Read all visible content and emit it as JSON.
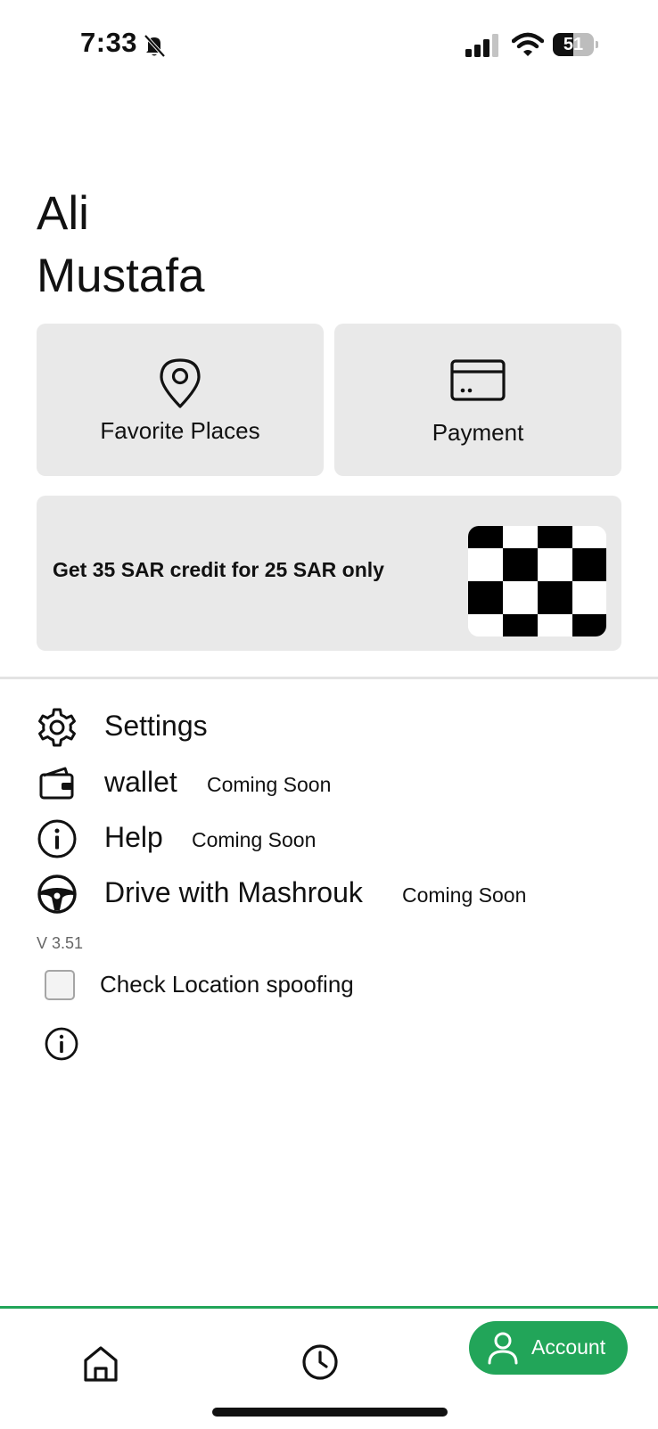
{
  "status_bar": {
    "time": "7:33",
    "battery_percent": 51,
    "battery_label": "51",
    "icons": [
      "bell-slash-icon",
      "cellular-signal-icon",
      "wifi-icon",
      "battery-icon"
    ]
  },
  "profile": {
    "first_name": "Ali",
    "last_name": "Mustafa"
  },
  "tiles": {
    "favorite_places": {
      "label": "Favorite Places",
      "icon": "map-pin-icon"
    },
    "payment": {
      "label": "Payment",
      "icon": "credit-card-icon"
    }
  },
  "promo": {
    "text": "Get 35 SAR credit for 25 SAR only",
    "image": "checkered-flag-icon"
  },
  "menu": {
    "settings": {
      "label": "Settings",
      "icon": "gear-icon"
    },
    "wallet": {
      "label": "wallet",
      "badge": "Coming Soon",
      "icon": "wallet-icon"
    },
    "help": {
      "label": "Help",
      "badge": "Coming Soon",
      "icon": "info-circle-icon"
    },
    "drive": {
      "label": "Drive with Mashrouk",
      "badge": "Coming Soon",
      "icon": "steering-wheel-icon"
    }
  },
  "version": "V 3.51",
  "location_spoofing": {
    "label": "Check Location spoofing",
    "checked": false
  },
  "bottom_nav": {
    "home_icon": "home-icon",
    "history_icon": "clock-icon",
    "account_label": "Account",
    "account_icon": "user-icon",
    "active": "Account"
  },
  "colors": {
    "accent": "#22a559",
    "tile_background": "#e9e9e9",
    "text": "#111111"
  }
}
